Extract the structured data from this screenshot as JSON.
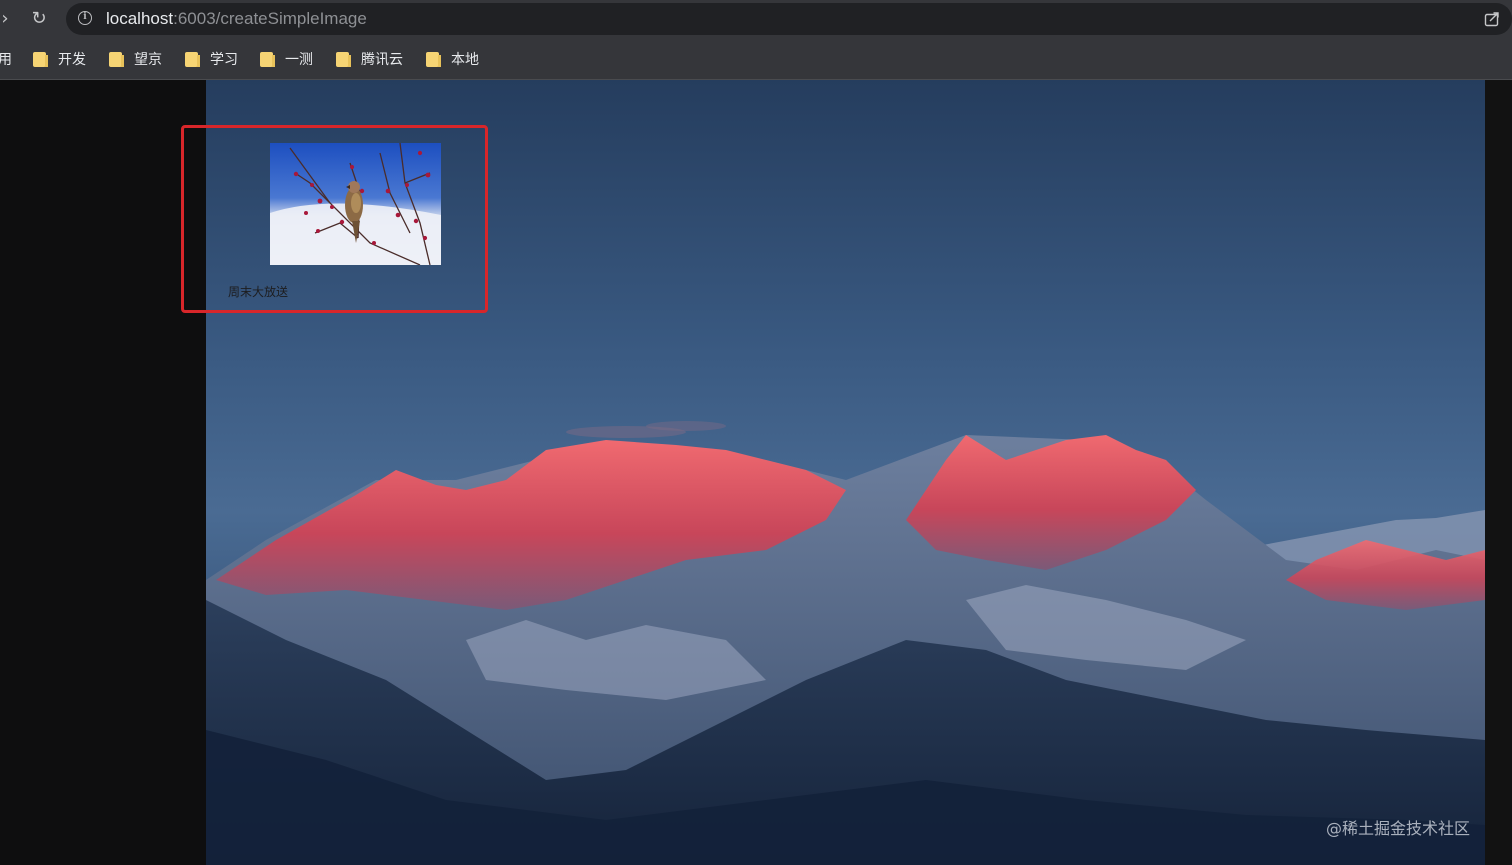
{
  "browser": {
    "url_host": "localhost",
    "url_path": ":6003/createSimpleImage",
    "bookmarks": [
      {
        "label": "用"
      },
      {
        "label": "开发"
      },
      {
        "label": "望京"
      },
      {
        "label": "学习"
      },
      {
        "label": "一测"
      },
      {
        "label": "腾讯云"
      },
      {
        "label": "本地"
      }
    ]
  },
  "page": {
    "card_caption": "周末大放送",
    "watermark": "@稀土掘金技术社区"
  },
  "colors": {
    "highlight_border": "#d8262a",
    "folder": "#f6d474",
    "alpenglow": "#e9585f"
  },
  "icons": {
    "forward": "forward-arrow-icon",
    "reload": "reload-icon",
    "info": "info-icon",
    "share": "share-icon",
    "folder": "folder-icon"
  }
}
